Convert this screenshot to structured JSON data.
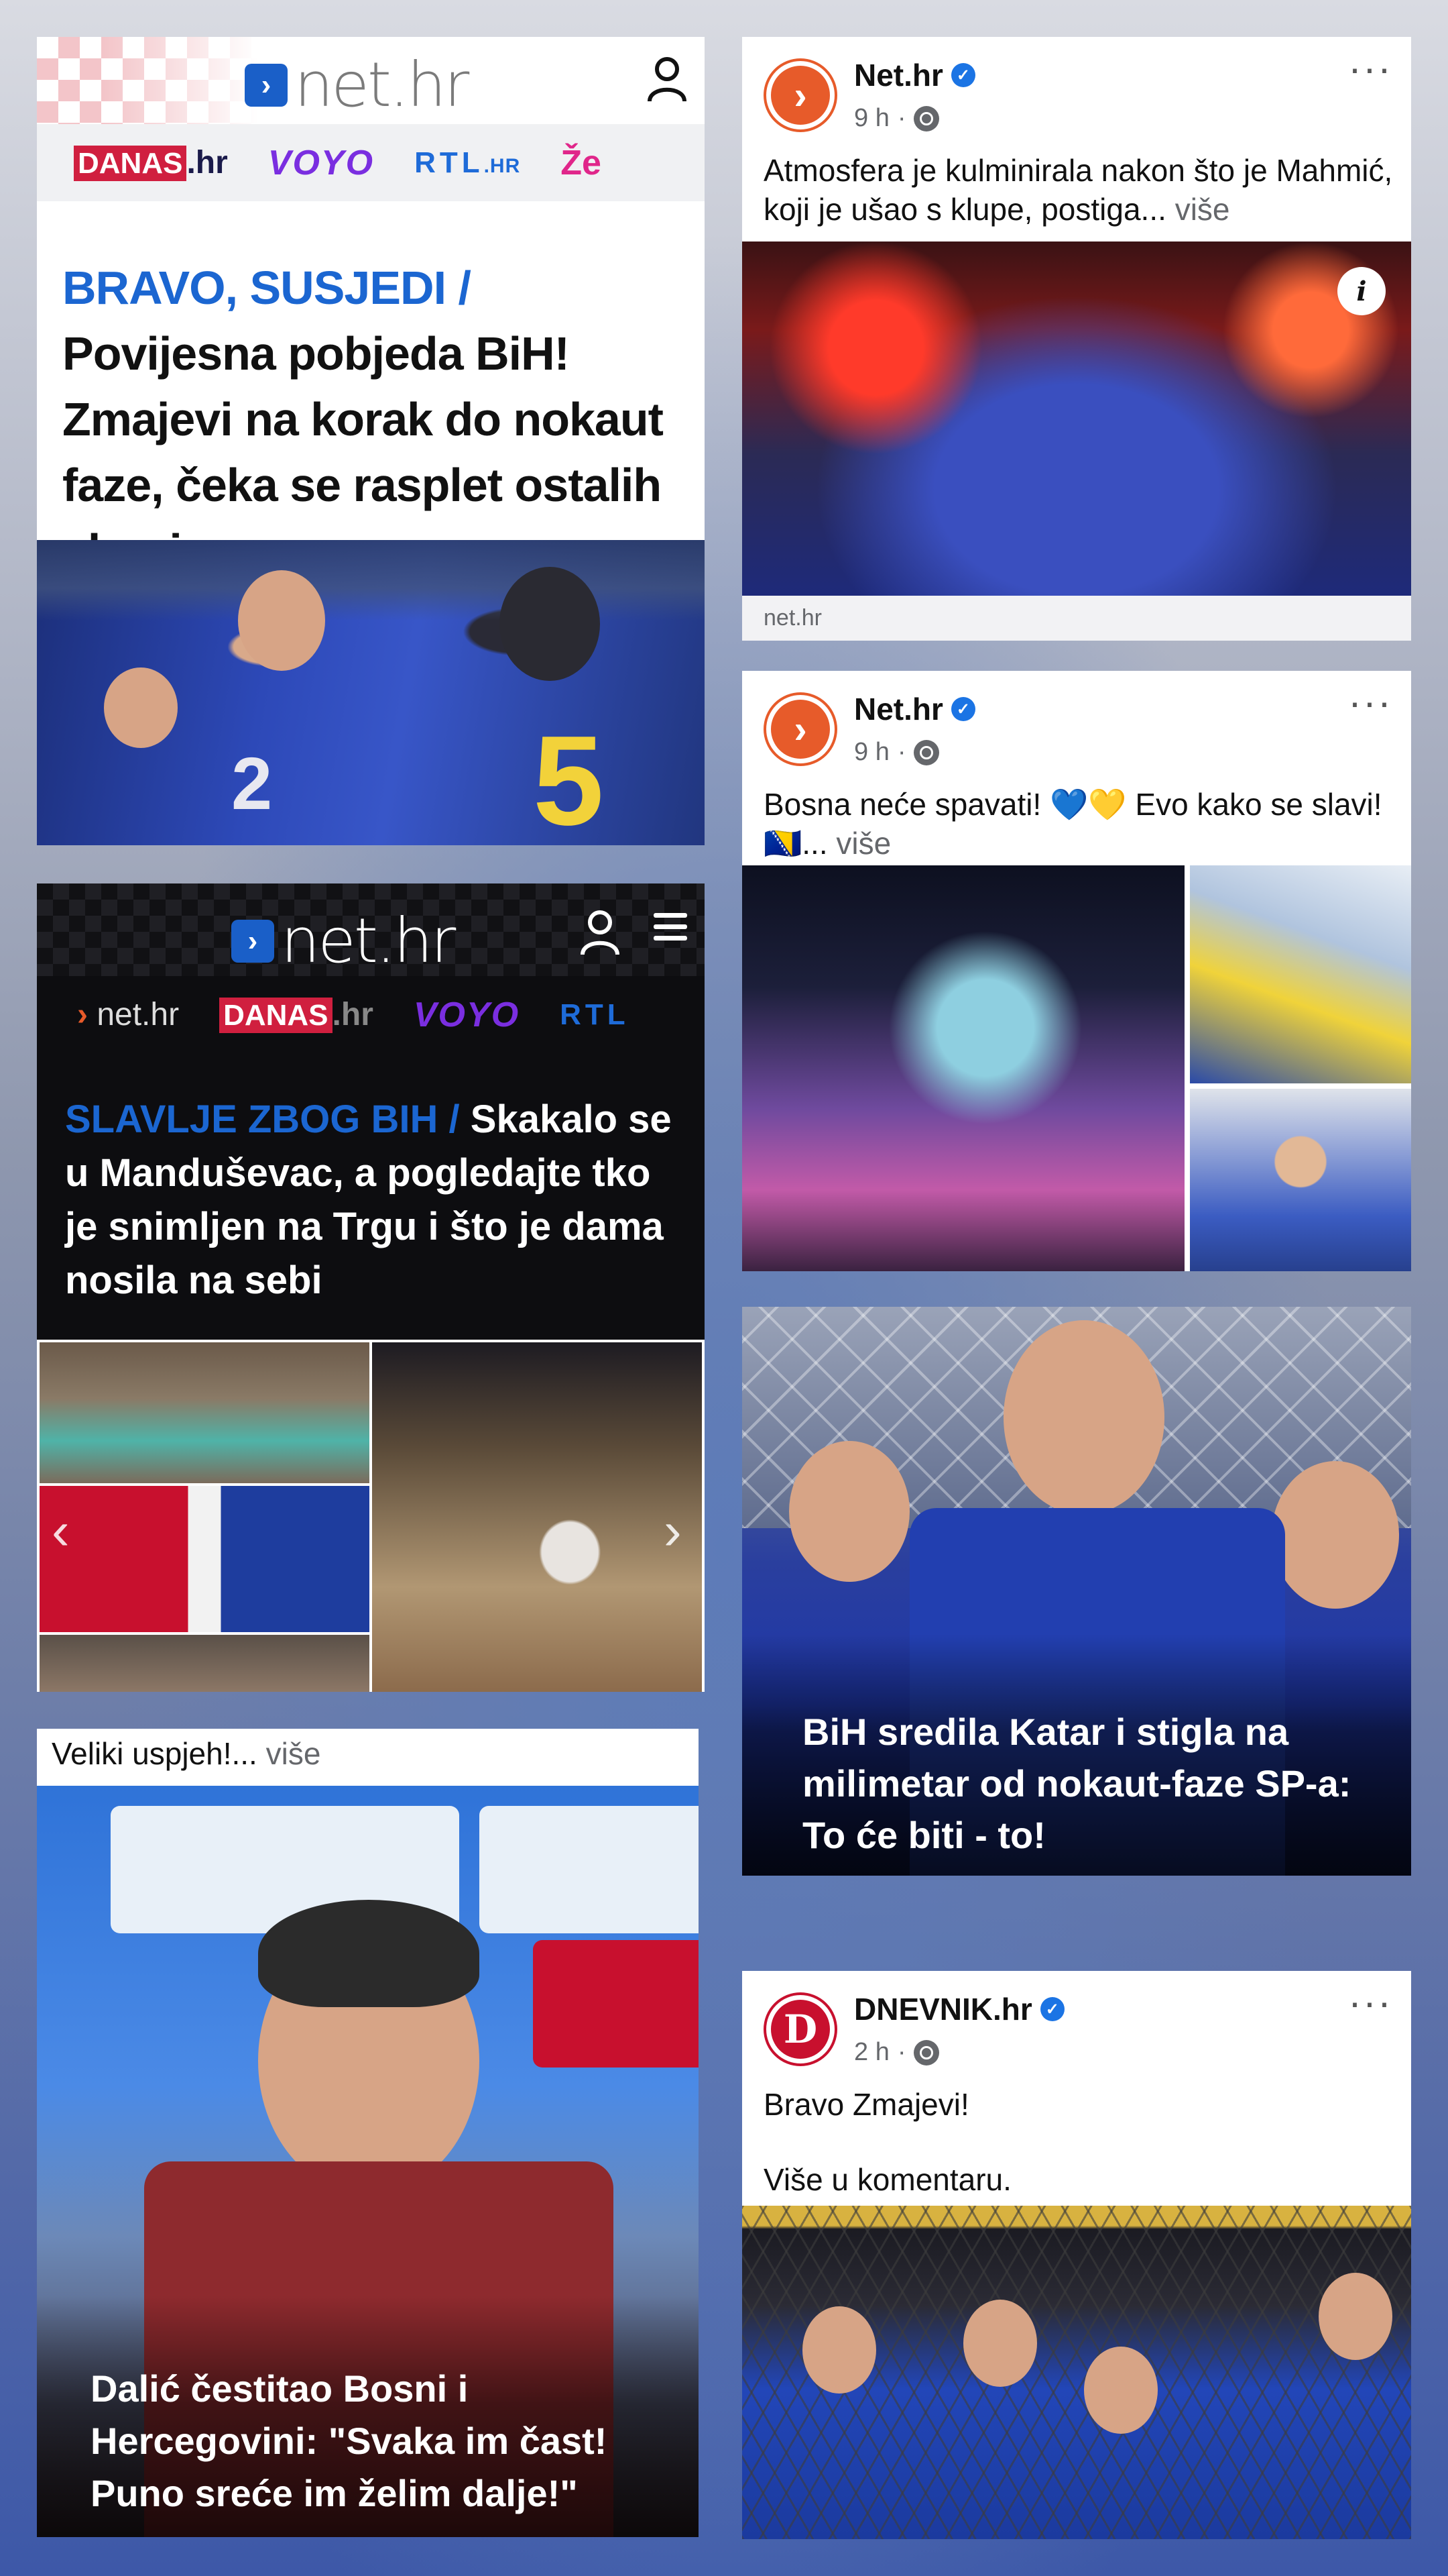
{
  "left_card_1": {
    "logo": "net.hr",
    "brands": [
      "DANAS",
      ".hr",
      "VOYO",
      "RTL",
      ".HR",
      "Že"
    ],
    "kicker": "BRAVO, SUSJEDI /",
    "title": "Povijesna pobjeda BiH! Zmajevi na korak do nokaut faze, čeka se rasplet ostalih skupina"
  },
  "left_card_2": {
    "logo": "net.hr",
    "brands": [
      "net.hr",
      "DANAS",
      ".hr",
      "VOYO",
      "RTL"
    ],
    "kicker": "SLAVLJE ZBOG BIH /",
    "title": "Skakalo se u Manduševac, a pogledajte tko je snimljen na Trgu i što je dama nosila na sebi"
  },
  "left_card_3": {
    "caption": "Veliki uspjeh!...",
    "more": "više",
    "title": "Dalić čestitao Bosni i Hercegovini: \"Svaka im čast! Puno sreće im želim dalje!\""
  },
  "post_1": {
    "page_name": "Net.hr",
    "time": "9 h",
    "text": "Atmosfera je kulminirala nakon što je Mahmić, koji je ušao s klupe, postiga...",
    "more": "više",
    "source": "net.hr"
  },
  "post_2": {
    "page_name": "Net.hr",
    "time": "9 h",
    "text": "Bosna neće spavati! 💙💛 Evo kako se slavi! 🇧🇦...",
    "more": "više"
  },
  "post_3": {
    "title": "BiH sredila Katar i stigla na milimetar od nokaut-faze SP-a: To će biti - to!"
  },
  "post_4": {
    "page_name": "DNEVNIK.hr",
    "time": "2 h",
    "line1": "Bravo Zmajevi!",
    "line2": "Više u komentaru."
  },
  "icons": {
    "verified": "verified-badge-icon",
    "globe": "globe-icon",
    "more": "more-options-icon",
    "info": "info-icon",
    "user": "user-icon",
    "menu": "hamburger-menu-icon"
  },
  "colors": {
    "accent_blue": "#1b66d1",
    "net_orange": "#e75b2a",
    "danas_red": "#d01f3f",
    "voyo_purple": "#7a2ee0",
    "fb_verified": "#1b74e4"
  }
}
